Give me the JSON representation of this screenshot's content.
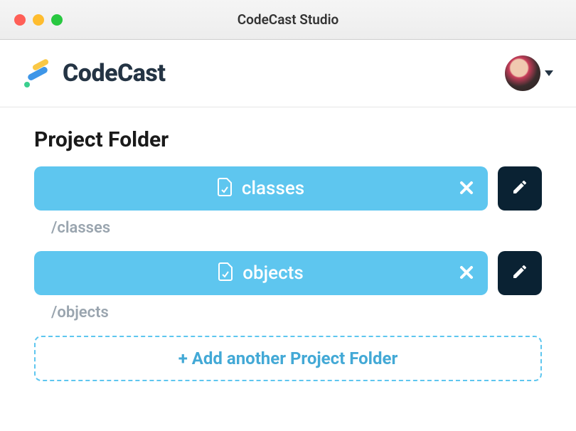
{
  "window": {
    "title": "CodeCast Studio"
  },
  "header": {
    "brand": "CodeCast"
  },
  "section": {
    "title": "Project Folder"
  },
  "folders": [
    {
      "label": "classes",
      "path": "/classes"
    },
    {
      "label": "objects",
      "path": "/objects"
    }
  ],
  "actions": {
    "add_folder": "+ Add another Project Folder"
  }
}
